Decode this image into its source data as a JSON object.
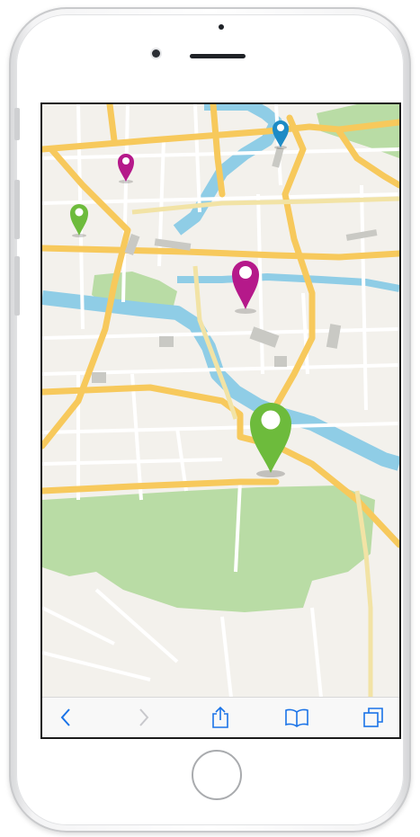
{
  "device": {
    "model": "iPhone",
    "color": "silver"
  },
  "colors": {
    "land": "#f3f1ec",
    "water": "#8fcde6",
    "park": "#b9dca5",
    "major_road": "#f7c95c",
    "minor_road": "#ffffff",
    "building": "#c9c9c4",
    "toolbar_icon_active": "#1a73e8",
    "toolbar_icon_disabled": "#c8c8cc"
  },
  "map": {
    "pins": [
      {
        "name": "magenta-small",
        "color": "#b5198a"
      },
      {
        "name": "green-small",
        "color": "#6dbb3c"
      },
      {
        "name": "blue-small",
        "color": "#1d8bc5"
      },
      {
        "name": "magenta-medium",
        "color": "#b5198a"
      },
      {
        "name": "green-large",
        "color": "#6dbb3c"
      }
    ]
  },
  "toolbar": {
    "buttons": [
      {
        "icon": "back-icon",
        "enabled": true
      },
      {
        "icon": "forward-icon",
        "enabled": false
      },
      {
        "icon": "share-icon",
        "enabled": true
      },
      {
        "icon": "bookmarks-icon",
        "enabled": true
      },
      {
        "icon": "tabs-icon",
        "enabled": true
      }
    ]
  }
}
